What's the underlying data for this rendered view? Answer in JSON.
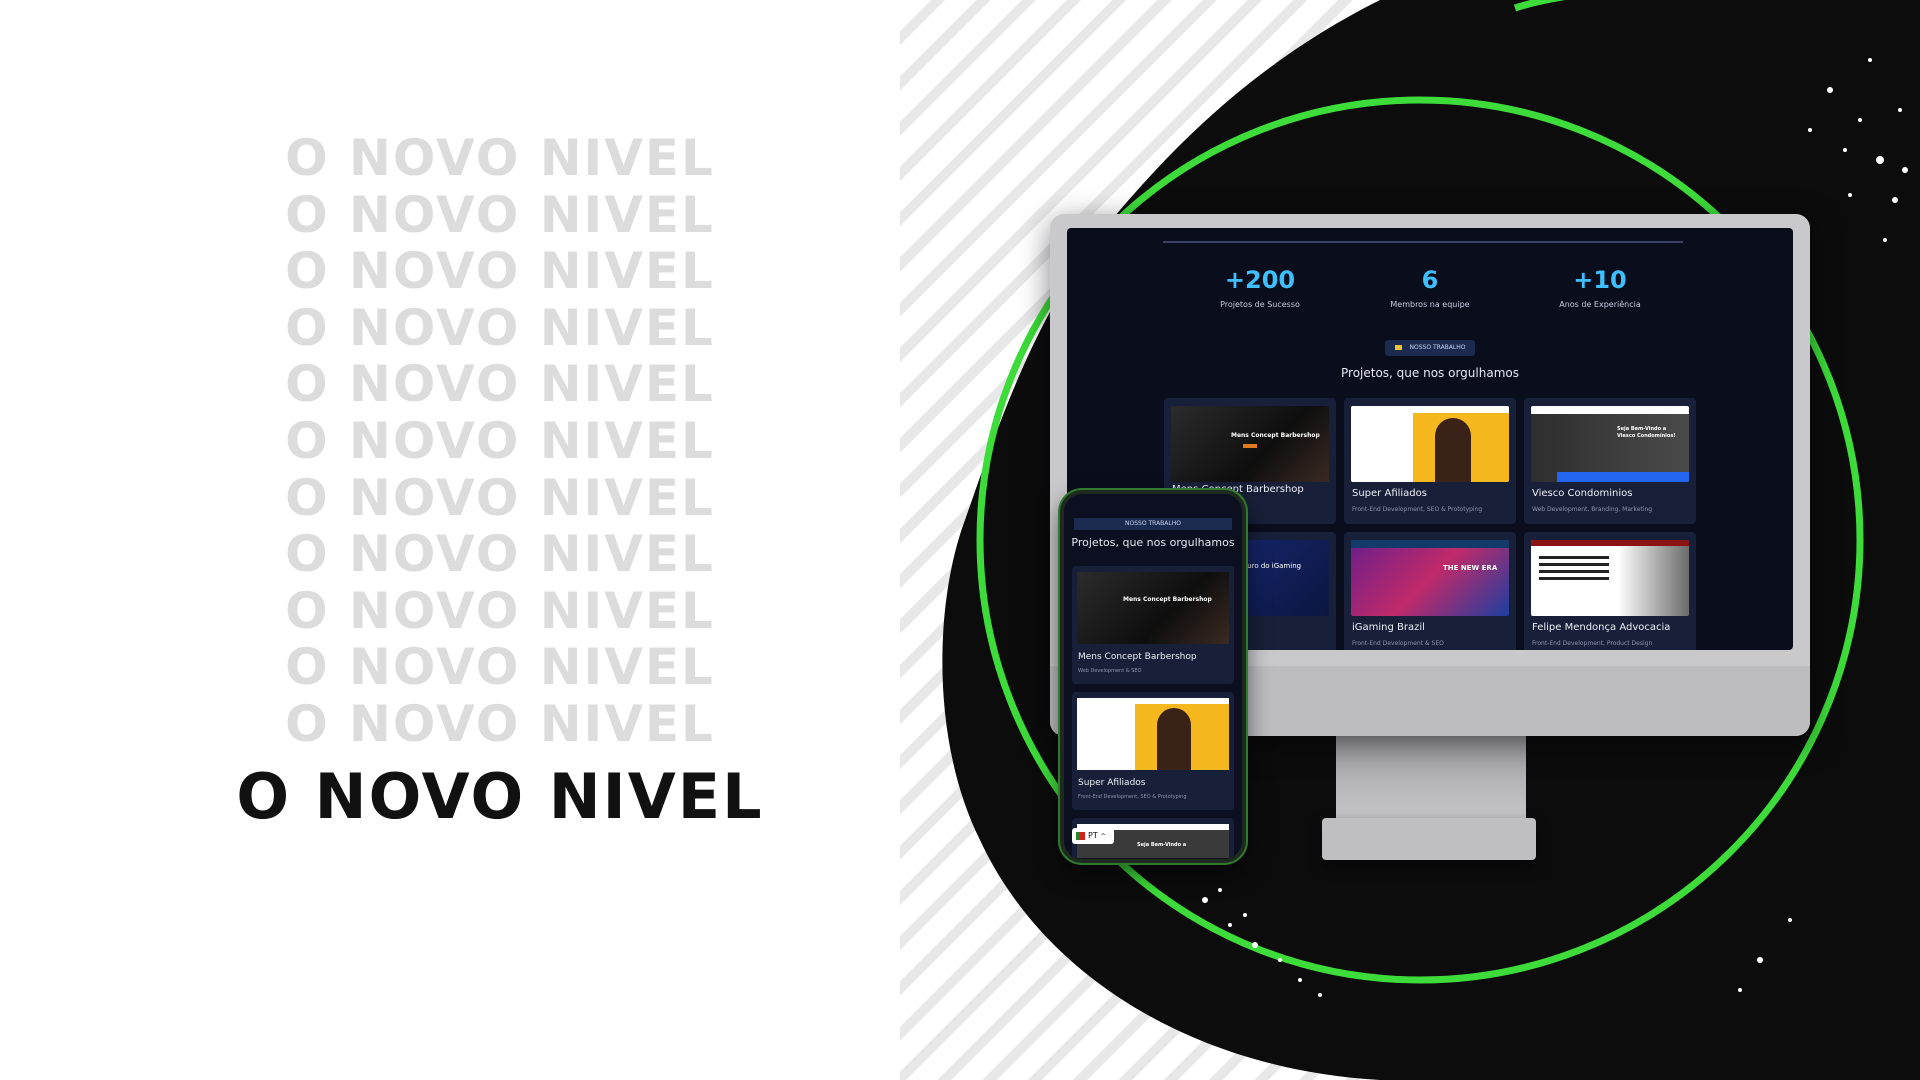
{
  "headline": {
    "ghost_lines": [
      "O NOVO NIVEL",
      "O NOVO NIVEL",
      "O NOVO NIVEL",
      "O NOVO NIVEL",
      "O NOVO NIVEL",
      "O NOVO NIVEL",
      "O NOVO NIVEL",
      "O NOVO NIVEL",
      "O NOVO NIVEL",
      "O NOVO NIVEL",
      "O NOVO NIVEL"
    ],
    "hero": "O NOVO NIVEL"
  },
  "desktop": {
    "stats": [
      {
        "value": "+200",
        "label": "Projetos de Sucesso"
      },
      {
        "value": "6",
        "label": "Membros na equipe"
      },
      {
        "value": "+10",
        "label": "Anos de Experiência"
      }
    ],
    "badge": "NOSSO TRABALHO",
    "section_title": "Projetos, que nos orgulhamos",
    "cards": [
      {
        "title": "Mens Concept Barbershop",
        "subtitle": "",
        "thumb_heading": "Mens Concept Barbershop"
      },
      {
        "title": "Super Afiliados",
        "subtitle": "Front-End Development, SEO & Prototyping",
        "thumb_heading": ""
      },
      {
        "title": "Viesco Condominios",
        "subtitle": "Web Development, Branding, Marketing",
        "thumb_heading": "Seja Bem-Vindo a Viesco Condomínios!"
      },
      {
        "title": "",
        "subtitle": "",
        "thumb_heading": "o futuro do iGaming"
      },
      {
        "title": "iGaming Brazil",
        "subtitle": "Front-End Development & SEO",
        "thumb_heading": "THE NEW ERA"
      },
      {
        "title": "Felipe Mendonça Advocacia",
        "subtitle": "Front-End Development, Product Design",
        "thumb_heading": ""
      }
    ]
  },
  "mobile": {
    "badge": "NOSSO TRABALHO",
    "section_title": "Projetos, que nos orgulhamos",
    "cards": [
      {
        "title": "Mens Concept Barbershop",
        "subtitle": "Web Development & SEO",
        "thumb_heading": "Mens Concept Barbershop"
      },
      {
        "title": "Super Afiliados",
        "subtitle": "Front-End Development, SEO & Prototyping",
        "thumb_heading": ""
      }
    ],
    "peek_heading": "Seja Bem-Vindo a",
    "language": "PT"
  },
  "colors": {
    "accent_green": "#3ddc3a",
    "stat_blue": "#3ec0ff",
    "dark_bg": "#0a0d1c",
    "card_bg": "#172038"
  }
}
